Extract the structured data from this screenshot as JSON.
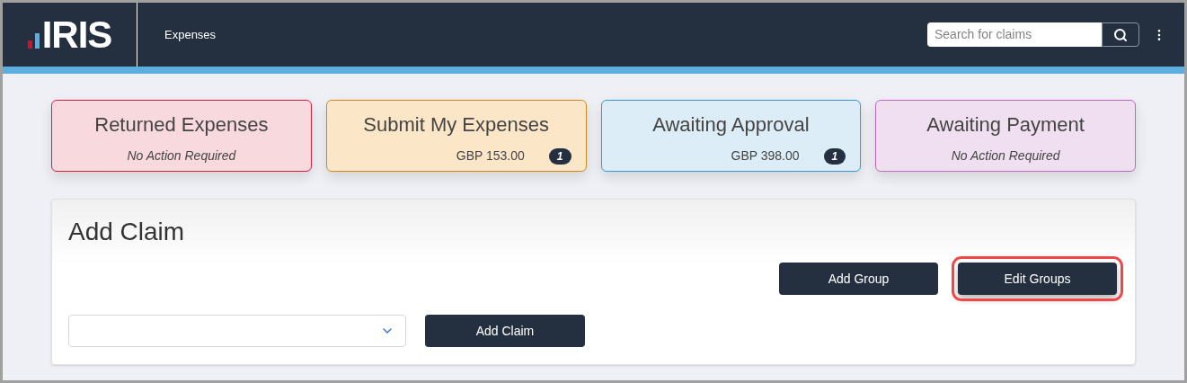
{
  "header": {
    "logo": "IRIS",
    "nav": "Expenses",
    "search": {
      "placeholder": "Search for claims"
    }
  },
  "cards": [
    {
      "title": "Returned Expenses",
      "kind": "note",
      "note": "No Action Required",
      "color": "#d9213f"
    },
    {
      "title": "Submit My Expenses",
      "kind": "amount",
      "amount": "GBP 153.00",
      "count": "1",
      "color": "#d08a1e"
    },
    {
      "title": "Awaiting Approval",
      "kind": "amount",
      "amount": "GBP 398.00",
      "count": "1",
      "color": "#3b97d3"
    },
    {
      "title": "Awaiting Payment",
      "kind": "note",
      "note": "No Action Required",
      "color": "#c069c0"
    }
  ],
  "panel": {
    "title": "Add Claim",
    "group_buttons": [
      {
        "label": "Add Group",
        "highlighted": false
      },
      {
        "label": "Edit Groups",
        "highlighted": true
      }
    ],
    "add_button": "Add Claim"
  }
}
